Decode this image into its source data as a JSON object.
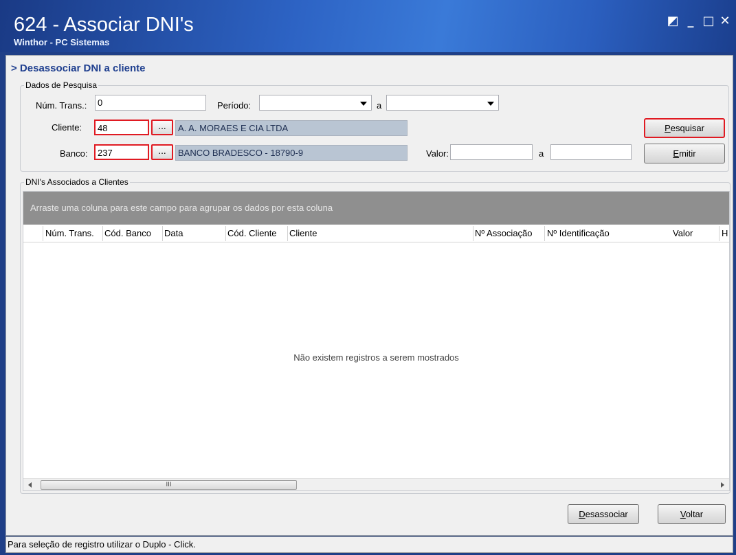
{
  "window": {
    "title": "624 - Associar DNI's",
    "subtitle": "Winthor - PC Sistemas",
    "controls": {
      "restore": "◩",
      "minimize": "_",
      "maximize": "□",
      "close": "✕"
    }
  },
  "section": {
    "title": "> Desassociar DNI a cliente"
  },
  "search": {
    "group_label": "Dados de Pesquisa",
    "num_trans_label": "Núm. Trans.:",
    "num_trans_value": "0",
    "periodo_label": "Período:",
    "periodo_from": "",
    "periodo_sep": "a",
    "periodo_to": "",
    "cliente_label": "Cliente:",
    "cliente_code": "48",
    "cliente_name": "A. A. MORAES E CIA LTDA",
    "banco_label": "Banco:",
    "banco_code": "237",
    "banco_name": "BANCO BRADESCO - 18790-9",
    "lookup_label": "...",
    "valor_label": "Valor:",
    "valor_from": "",
    "valor_sep": "a",
    "valor_to": "",
    "pesquisar_key": "P",
    "pesquisar_rest": "esquisar",
    "emitir_key": "E",
    "emitir_rest": "mitir"
  },
  "grid": {
    "group_label": "DNI's Associados a Clientes",
    "group_panel_text": "Arraste uma coluna para este campo para agrupar os dados por esta coluna",
    "columns": [
      "Núm. Trans.",
      "Cód. Banco",
      "Data",
      "Cód. Cliente",
      "Cliente",
      "Nº Associação",
      "Nº Identificação",
      "Valor",
      "H"
    ],
    "empty_message": "Não existem registros a serem mostrados",
    "scroll_thumb_grip": "III"
  },
  "footer": {
    "desassociar_key": "D",
    "desassociar_rest": "esassociar",
    "voltar_key": "V",
    "voltar_rest": "oltar"
  },
  "status": {
    "text": "Para seleção de registro utilizar o Duplo - Click."
  },
  "colors": {
    "highlight": "#e01a22",
    "title_text": "#1f3f8f",
    "readonly_field": "#b9c5d3"
  }
}
